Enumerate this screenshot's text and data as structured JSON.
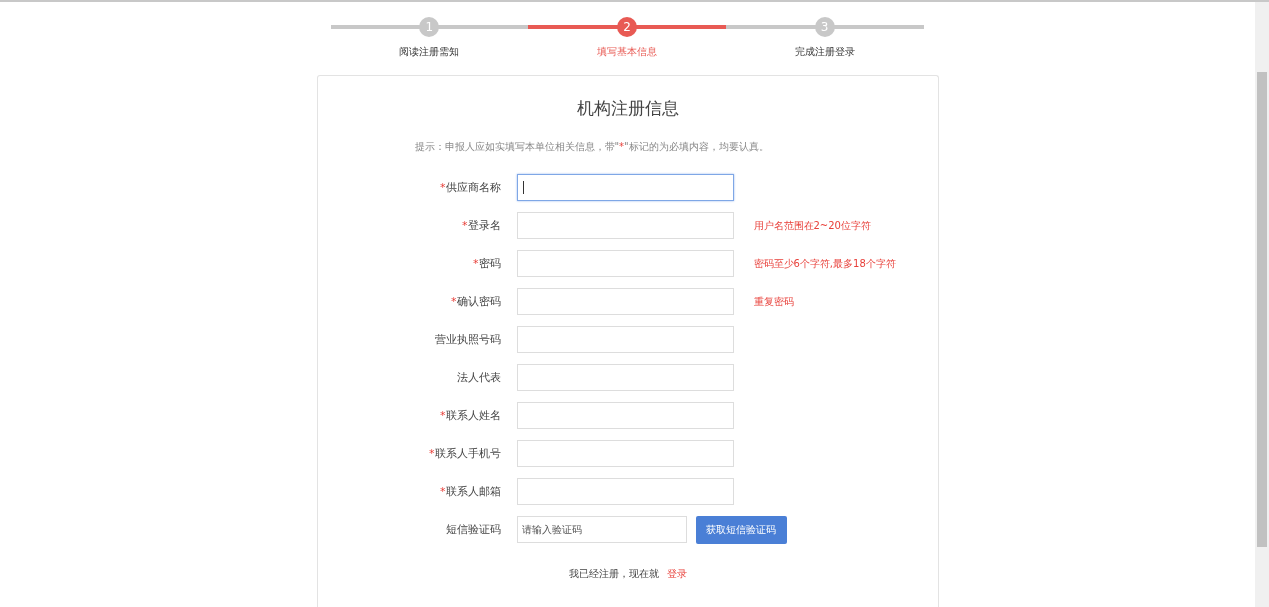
{
  "steps": [
    {
      "number": "1",
      "label": "阅读注册需知",
      "selected": false
    },
    {
      "number": "2",
      "label": "填写基本信息",
      "selected": true
    },
    {
      "number": "3",
      "label": "完成注册登录",
      "selected": false
    }
  ],
  "form": {
    "title": "机构注册信息",
    "hint": {
      "before": "提示：申报人应如实填写本单位相关信息，带\"",
      "mark": "*",
      "after": "\"标记的为必填内容，均要认真。"
    },
    "fields": [
      {
        "mark": "*",
        "label": "供应商名称",
        "focused": true
      },
      {
        "mark": "*",
        "label": "登录名",
        "focused": false,
        "note": "用户名范围在2~20位字符"
      },
      {
        "mark": "*",
        "label": "密码",
        "focused": false,
        "note": "密码至少6个字符,最多18个字符"
      },
      {
        "mark": "*",
        "label": "确认密码",
        "focused": false,
        "note": "重复密码"
      },
      {
        "label": "营业执照号码",
        "focused": false
      },
      {
        "label": "法人代表",
        "focused": false
      },
      {
        "mark": "*",
        "label": "联系人姓名",
        "focused": false
      },
      {
        "mark": "*",
        "label": "联系人手机号",
        "focused": false
      },
      {
        "mark": "*",
        "label": "联系人邮箱",
        "focused": false
      }
    ],
    "sms": {
      "label": "短信验证码",
      "placeholder": "请输入验证码",
      "button": "获取短信验证码"
    },
    "footer": {
      "text": "我已经注册，现在就",
      "link": "登录"
    }
  }
}
